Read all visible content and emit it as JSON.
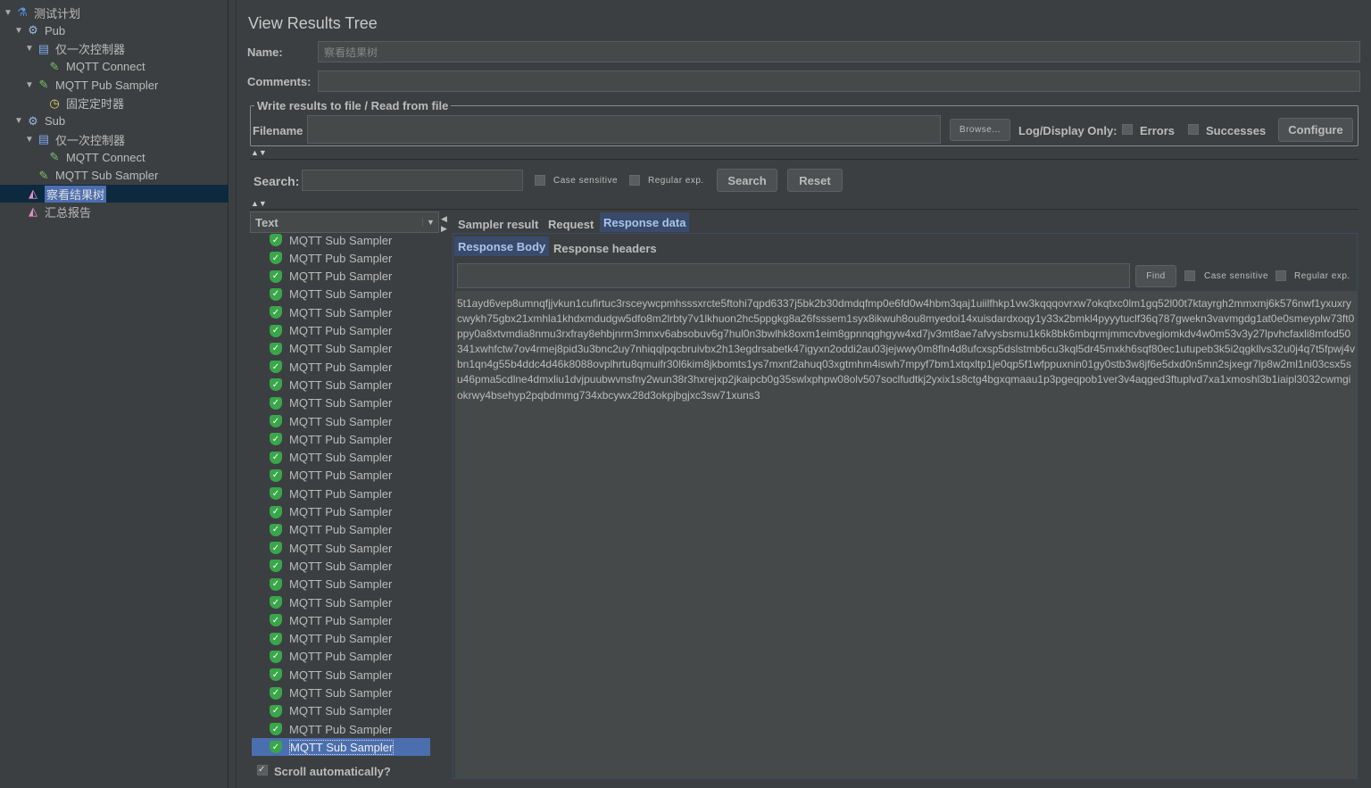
{
  "tree": [
    {
      "label": "测试计划",
      "icon": "test-plan-icon",
      "level": 0,
      "arrow": true
    },
    {
      "label": "Pub",
      "icon": "thread-group-gear-icon",
      "level": 1,
      "arrow": true
    },
    {
      "label": "仅一次控制器",
      "icon": "controller-icon",
      "level": 2,
      "arrow": true
    },
    {
      "label": "MQTT Connect",
      "icon": "sampler-pipette-icon",
      "level": 3,
      "arrow": false
    },
    {
      "label": "MQTT Pub Sampler",
      "icon": "sampler-pipette-icon",
      "level": 2,
      "arrow": true
    },
    {
      "label": "固定定时器",
      "icon": "timer-icon",
      "level": 3,
      "arrow": false
    },
    {
      "label": "Sub",
      "icon": "thread-group-gear-icon",
      "level": 1,
      "arrow": true
    },
    {
      "label": "仅一次控制器",
      "icon": "controller-icon",
      "level": 2,
      "arrow": true
    },
    {
      "label": "MQTT Connect",
      "icon": "sampler-pipette-icon",
      "level": 3,
      "arrow": false
    },
    {
      "label": "MQTT Sub Sampler",
      "icon": "sampler-pipette-icon",
      "level": 2,
      "arrow": false
    },
    {
      "label": "察看结果树",
      "icon": "listener-chart-icon",
      "level": 1,
      "arrow": false,
      "selected": true
    },
    {
      "label": "汇总报告",
      "icon": "listener-chart-icon",
      "level": 1,
      "arrow": false
    }
  ],
  "panel": {
    "title": "View Results Tree",
    "name_label": "Name:",
    "name_value": "察看结果树",
    "comments_label": "Comments:",
    "comments_value": "",
    "file_group": "Write results to file / Read from file",
    "filename_label": "Filename",
    "filename_value": "",
    "browse": "Browse...",
    "log_only": "Log/Display Only:",
    "errors": "Errors",
    "successes": "Successes",
    "configure": "Configure",
    "search_label": "Search:",
    "search_value": "",
    "case_sensitive": "Case sensitive",
    "regex": "Regular exp.",
    "search_btn": "Search",
    "reset_btn": "Reset",
    "renderer": "Text",
    "tabs": [
      "Sampler result",
      "Request",
      "Response data"
    ],
    "active_tab": "Response data",
    "subtabs": [
      "Response Body",
      "Response headers"
    ],
    "find_btn": "Find",
    "find_case": "Case sensitive",
    "find_regex": "Regular exp.",
    "scroll_auto": "Scroll automatically?",
    "scroll_auto_checked": true
  },
  "results": [
    "MQTT Sub Sampler",
    "MQTT Pub Sampler",
    "MQTT Pub Sampler",
    "MQTT Sub Sampler",
    "MQTT Sub Sampler",
    "MQTT Pub Sampler",
    "MQTT Sub Sampler",
    "MQTT Pub Sampler",
    "MQTT Sub Sampler",
    "MQTT Sub Sampler",
    "MQTT Sub Sampler",
    "MQTT Pub Sampler",
    "MQTT Sub Sampler",
    "MQTT Pub Sampler",
    "MQTT Pub Sampler",
    "MQTT Pub Sampler",
    "MQTT Pub Sampler",
    "MQTT Sub Sampler",
    "MQTT Sub Sampler",
    "MQTT Sub Sampler",
    "MQTT Sub Sampler",
    "MQTT Pub Sampler",
    "MQTT Pub Sampler",
    "MQTT Pub Sampler",
    "MQTT Sub Sampler",
    "MQTT Sub Sampler",
    "MQTT Sub Sampler",
    "MQTT Pub Sampler",
    "MQTT Sub Sampler"
  ],
  "selected_result": 28,
  "response_body": "5t1ayd6vep8umnqfjjvkun1cufirtuc3rsceywcpmhsssxrcte5ftohi7qpd6337j5bk2b30dmdqfmp0e6fd0w4hbm3qaj1uiilfhkp1vw3kqqqovrxw7okqtxc0lm1gq52l00t7ktayrgh2mmxmj6k576nwf1yxuxrycwykh75gbx21xmhla1khdxmdudgw5dfo8m2lrbty7v1lkhuon2hc5ppgkg8a26fsssem1syx8ikwuh8ou8myedoi14xuisdardxoqy1y33x2bmkl4pyyytuclf36q787gwekn3vavmgdg1at0e0smeyplw73ft0ppy0a8xtvmdia8nmu3rxfray8ehbjnrm3mnxv6absobuv6g7hul0n3bwlhk8oxm1eim8gpnnqghgyw4xd7jv3mt8ae7afvysbsmu1k6k8bk6mbqrmjmmcvbvegiomkdv4w0m53v3y27lpvhcfaxli8mfod50341xwhfctw7ov4rmej8pid3u3bnc2uy7nhiqqlpqcbruivbx2h13egdrsabetk47igyxn2oddi2au03jejwwy0m8fln4d8ufcxsp5dslstmb6cu3kql5dr45mxkh6sqf80ec1utupeb3k5i2qgkllvs32u0j4q7t5fpwj4vbn1qn4g55b4ddc4d46k8088ovplhrtu8qmuifr30l6kim8jkbomts1ys7mxnf2ahuq03xgtmhm4iswh7mpyf7bm1xtqxltp1je0qp5f1wfppuxnin01gy0stb3w8jf6e5dxd0n5mn2sjxegr7lp8w2ml1ni03csx5su46pma5cdlne4dmxliu1dvjpuubwvnsfny2wun38r3hxrejxp2jkaipcb0g35swlxphpw08olv507soclfudtkj2yxix1s8ctg4bgxqmaau1p3pgeqpob1ver3v4aqged3ftuplvd7xa1xmoshl3b1iaipl3032cwmgiokrwy4bsehyp2pqbdmmg734xbcywx28d3okpjbgjxc3sw71xuns3",
  "colors": {
    "background": "#3c3f41",
    "selection": "#4b6eaf",
    "success": "#3aa64a"
  }
}
